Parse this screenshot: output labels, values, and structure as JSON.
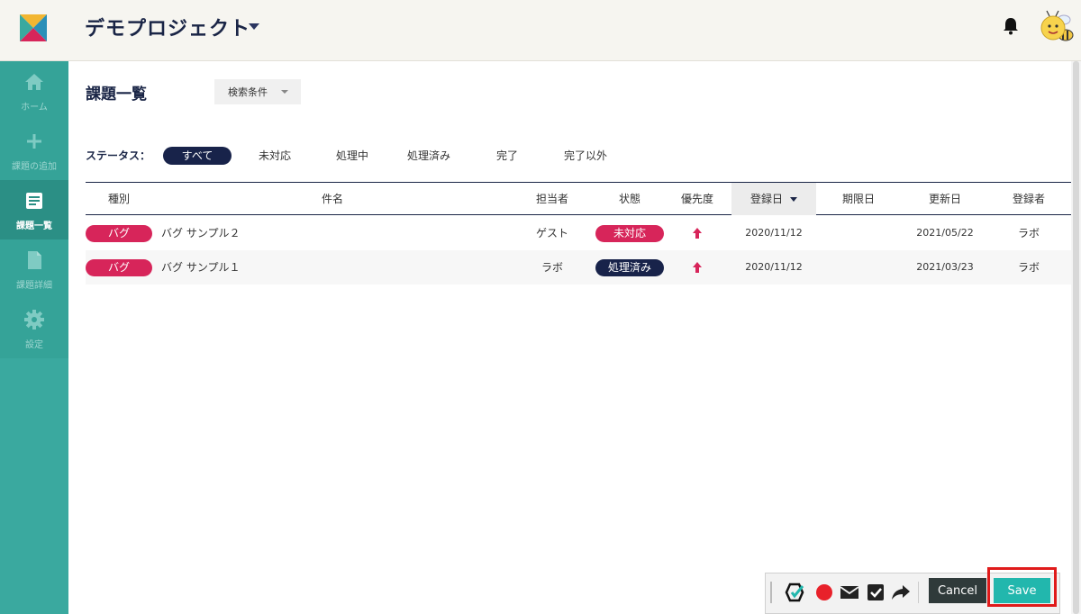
{
  "header": {
    "project_title": "デモプロジェクト"
  },
  "sidebar": {
    "items": [
      {
        "label": "ホーム",
        "icon": "home-icon"
      },
      {
        "label": "課題の追加",
        "icon": "plus-icon"
      },
      {
        "label": "課題一覧",
        "icon": "list-icon"
      },
      {
        "label": "課題詳細",
        "icon": "document-icon"
      },
      {
        "label": "設定",
        "icon": "gear-icon"
      }
    ],
    "active": "課題一覧"
  },
  "main": {
    "title": "課題一覧",
    "filter_label": "検索条件",
    "status_label": "ステータス：",
    "status_filters": [
      "すべて",
      "未対応",
      "処理中",
      "処理済み",
      "完了",
      "完了以外"
    ],
    "active_status": "すべて",
    "table": {
      "columns": [
        "種別",
        "件名",
        "担当者",
        "状態",
        "優先度",
        "登録日",
        "期限日",
        "更新日",
        "登録者"
      ],
      "sorted_column": "登録日",
      "rows": [
        {
          "type": "バグ",
          "subject": "バグ サンプル２",
          "assignee": "ゲスト",
          "status": "未対応",
          "priority": "high",
          "created": "2020/11/12",
          "due": "",
          "updated": "2021/05/22",
          "reporter": "ラボ"
        },
        {
          "type": "バグ",
          "subject": "バグ サンプル１",
          "assignee": "ラボ",
          "status": "処理済み",
          "priority": "high",
          "created": "2020/11/12",
          "due": "",
          "updated": "2021/03/23",
          "reporter": "ラボ"
        }
      ]
    }
  },
  "toolbar": {
    "cancel_label": "Cancel",
    "save_label": "Save"
  },
  "colors": {
    "sidebar": "#3aa99f",
    "navy": "#18234a",
    "bug": "#d7255a",
    "save": "#22b7ad",
    "highlight": "#e01b1b"
  }
}
